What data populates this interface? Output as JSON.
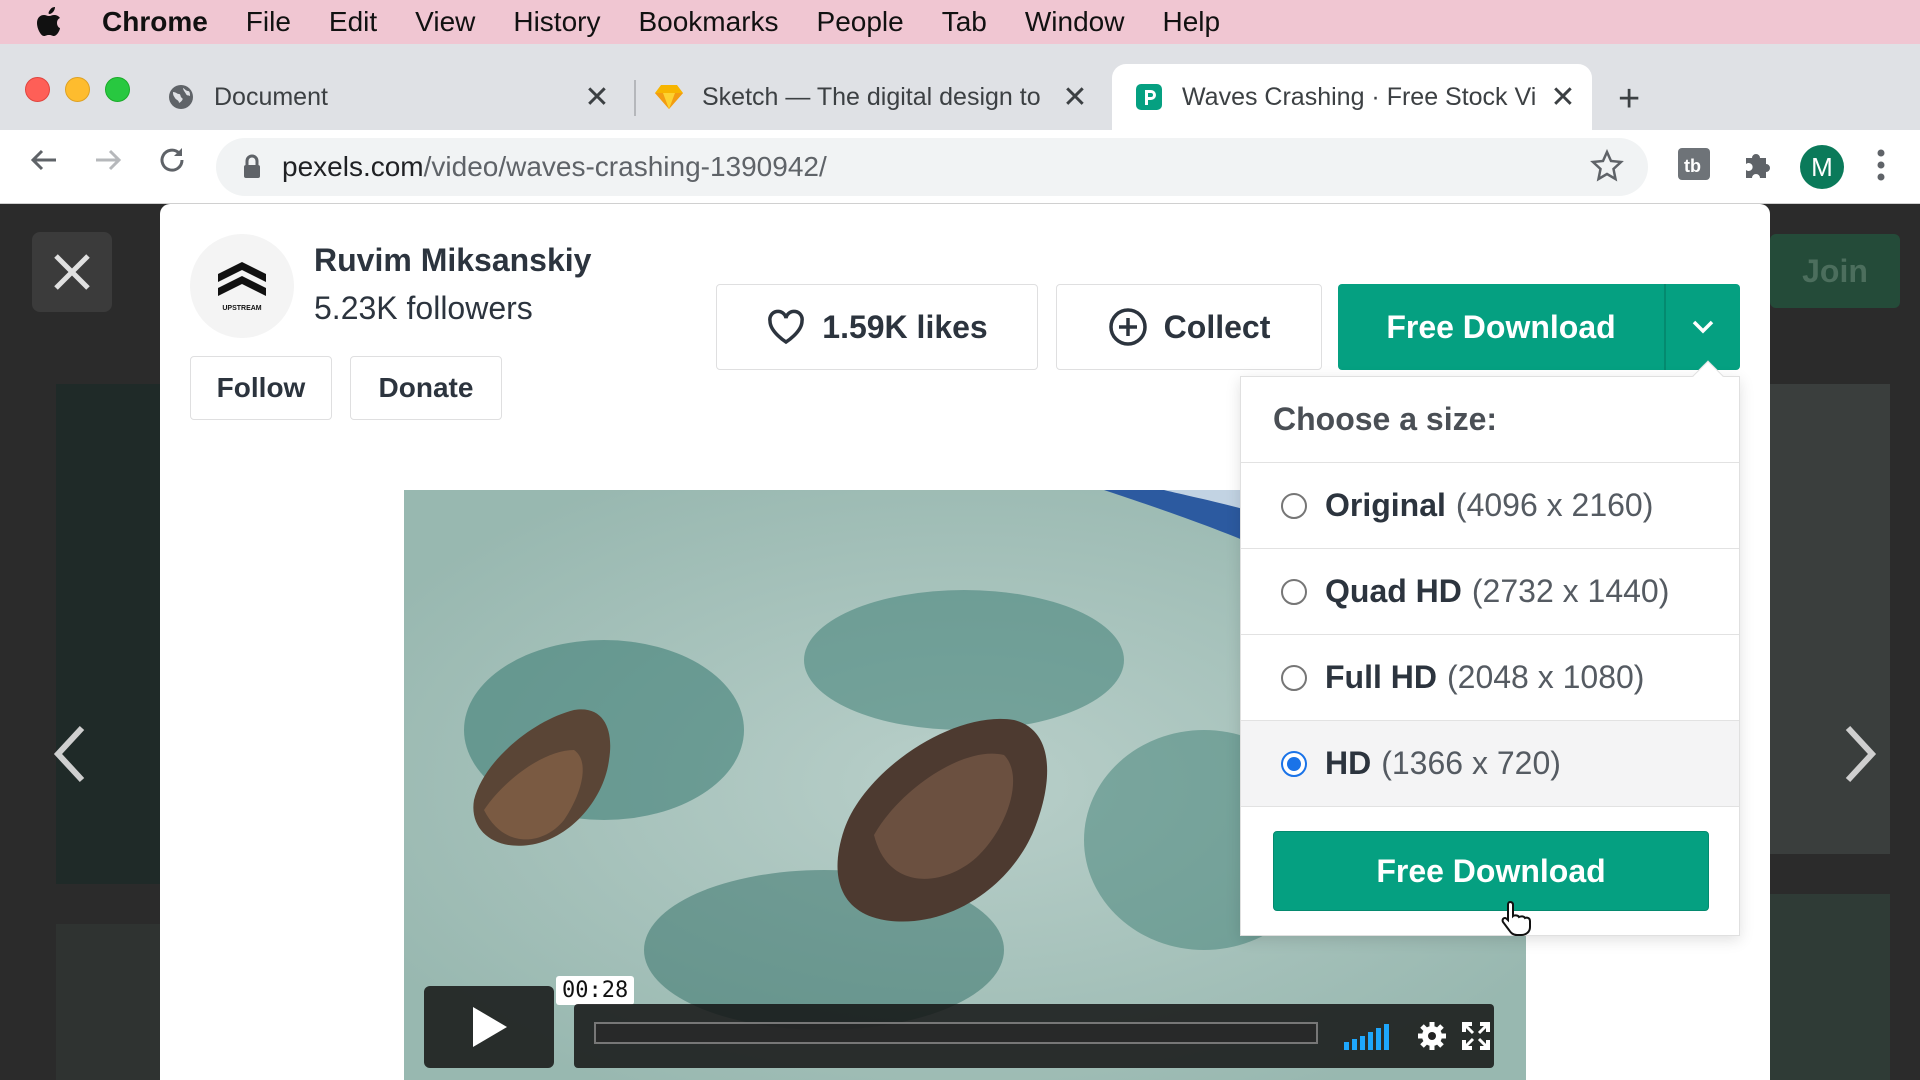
{
  "menubar": {
    "app": "Chrome",
    "items": [
      "File",
      "Edit",
      "View",
      "History",
      "Bookmarks",
      "People",
      "Tab",
      "Window",
      "Help"
    ]
  },
  "tabs": [
    {
      "title": "Document",
      "icon": "globe-icon",
      "active": false
    },
    {
      "title": "Sketch — The digital design to",
      "icon": "sketch-diamond-icon",
      "active": false
    },
    {
      "title": "Waves Crashing · Free Stock Vi",
      "icon": "pexels-icon",
      "active": true
    }
  ],
  "address_bar": {
    "domain": "pexels.com",
    "path": "/video/waves-crashing-1390942/"
  },
  "profile": {
    "initial": "M",
    "color": "#0b7a5a"
  },
  "background": {
    "join_label": "Join"
  },
  "author": {
    "name": "Ruvim Miksanskiy",
    "followers": "5.23K followers",
    "logo_text": "UPSTREAM",
    "follow_label": "Follow",
    "donate_label": "Donate"
  },
  "actions": {
    "likes_label": "1.59K likes",
    "collect_label": "Collect",
    "download_label": "Free Download"
  },
  "size_menu": {
    "heading": "Choose a size:",
    "options": [
      {
        "name": "Original",
        "dims": "(4096 x 2160)",
        "selected": false
      },
      {
        "name": "Quad HD",
        "dims": "(2732 x 1440)",
        "selected": false
      },
      {
        "name": "Full HD",
        "dims": "(2048 x 1080)",
        "selected": false
      },
      {
        "name": "HD",
        "dims": "(1366 x 720)",
        "selected": true
      }
    ],
    "download_label": "Free Download"
  },
  "video": {
    "time": "00:28"
  },
  "colors": {
    "accent": "#05a081",
    "radio_selected": "#1a73e8"
  }
}
